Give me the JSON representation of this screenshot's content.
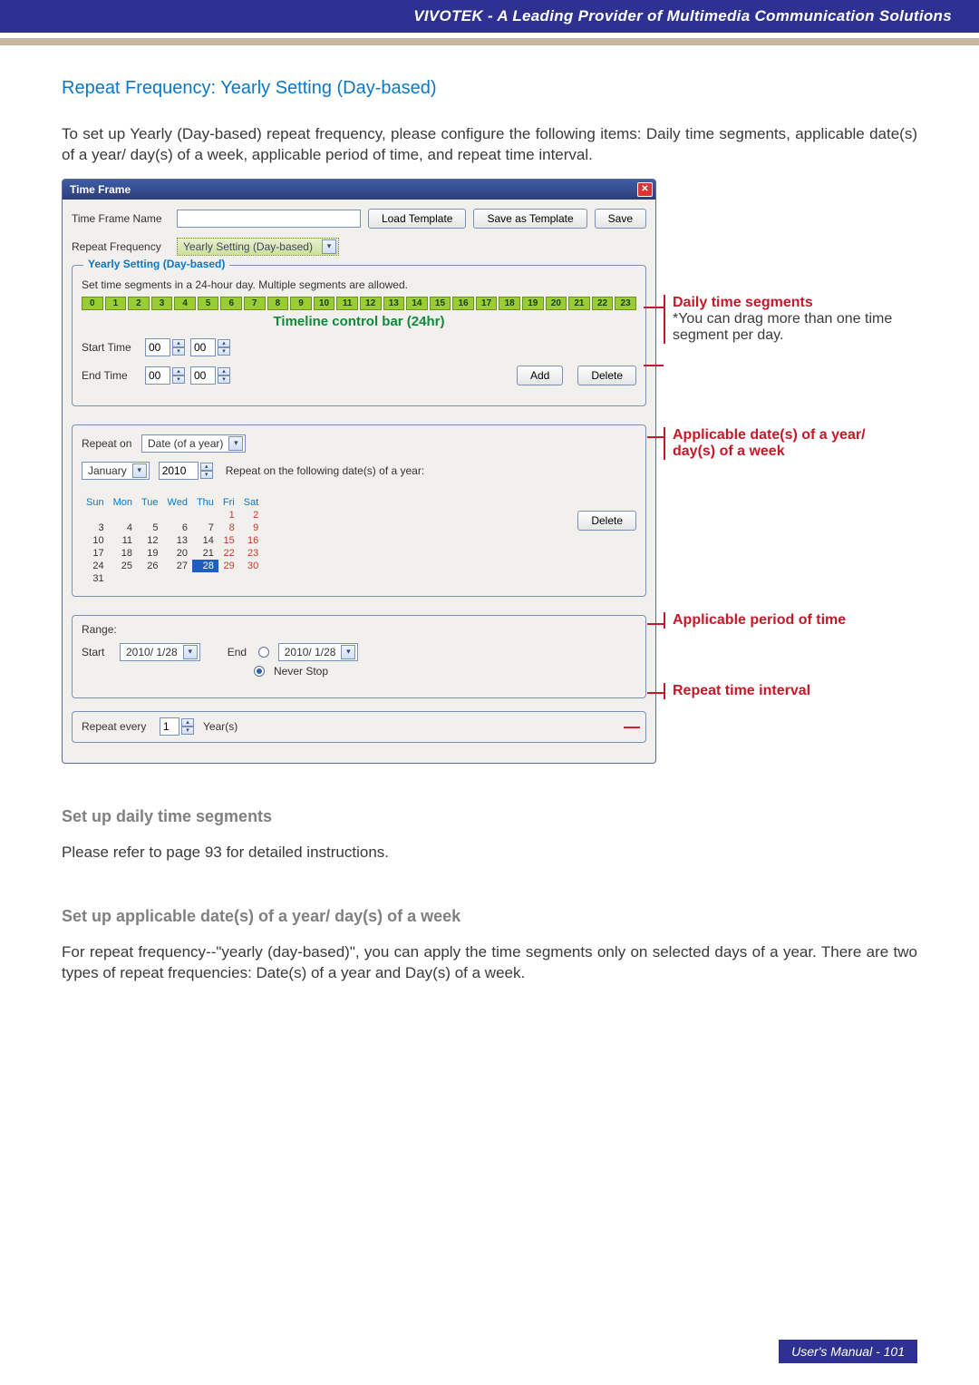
{
  "header": {
    "brand": "VIVOTEK - A Leading Provider of Multimedia Communication Solutions"
  },
  "title": "Repeat Frequency: Yearly Setting (Day-based)",
  "intro": "To set up Yearly (Day-based) repeat frequency, please configure the following items: Daily time segments, applicable date(s) of a year/ day(s) of a week, applicable period of time, and repeat time interval.",
  "dialog": {
    "title": "Time Frame",
    "name_label": "Time Frame Name",
    "name_value": "",
    "load_template": "Load Template",
    "save_as_template": "Save as Template",
    "save": "Save",
    "repeat_freq_label": "Repeat Frequency",
    "repeat_freq_value": "Yearly Setting (Day-based)",
    "group_legend": "Yearly Setting (Day-based)",
    "seg_note": "Set time segments in a 24-hour day. Multiple segments are allowed.",
    "timeline_caption": "Timeline control bar (24hr)",
    "hours": [
      "0",
      "1",
      "2",
      "3",
      "4",
      "5",
      "6",
      "7",
      "8",
      "9",
      "10",
      "11",
      "12",
      "13",
      "14",
      "15",
      "16",
      "17",
      "18",
      "19",
      "20",
      "21",
      "22",
      "23"
    ],
    "start_time_label": "Start Time",
    "end_time_label": "End Time",
    "start_h": "00",
    "start_m": "00",
    "end_h": "00",
    "end_m": "00",
    "add": "Add",
    "delete": "Delete",
    "repeat_on_label": "Repeat on",
    "repeat_on_value": "Date (of a year)",
    "month_value": "January",
    "year_value": "2010",
    "repeat_on_note": "Repeat on the following date(s) of a year:",
    "calendar": {
      "dow": [
        "Sun",
        "Mon",
        "Tue",
        "Wed",
        "Thu",
        "Fri",
        "Sat"
      ],
      "rows": [
        [
          "",
          "",
          "",
          "",
          "",
          "1",
          "2"
        ],
        [
          "3",
          "4",
          "5",
          "6",
          "7",
          "8",
          "9"
        ],
        [
          "10",
          "11",
          "12",
          "13",
          "14",
          "15",
          "16"
        ],
        [
          "17",
          "18",
          "19",
          "20",
          "21",
          "22",
          "23"
        ],
        [
          "24",
          "25",
          "26",
          "27",
          "28",
          "29",
          "30"
        ],
        [
          "31",
          "",
          "",
          "",
          "",
          "",
          ""
        ]
      ],
      "selected": "28"
    },
    "range_label": "Range:",
    "range_start_label": "Start",
    "range_start_value": "2010/ 1/28",
    "range_end_label": "End",
    "range_end_value": "2010/ 1/28",
    "never_stop": "Never Stop",
    "repeat_every_label": "Repeat every",
    "repeat_every_value": "1",
    "repeat_every_unit": "Year(s)"
  },
  "annotations": {
    "a1_title": "Daily time segments",
    "a1_note": "*You can drag more than one time segment per day.",
    "a2_title": "Applicable date(s) of a year/ day(s) of a week",
    "a3_title": "Applicable period of time",
    "a4_title": "Repeat time interval"
  },
  "sections": {
    "s1_h": "Set up daily time segments",
    "s1_p": "Please refer to page 93 for detailed instructions.",
    "s2_h": "Set up applicable date(s) of a year/ day(s) of a week",
    "s2_p": "For repeat frequency--\"yearly (day-based)\", you can apply the time segments only on selected days of a year. There are two types of repeat frequencies: Date(s) of a year and Day(s) of a week."
  },
  "footer": "User's Manual - 101"
}
